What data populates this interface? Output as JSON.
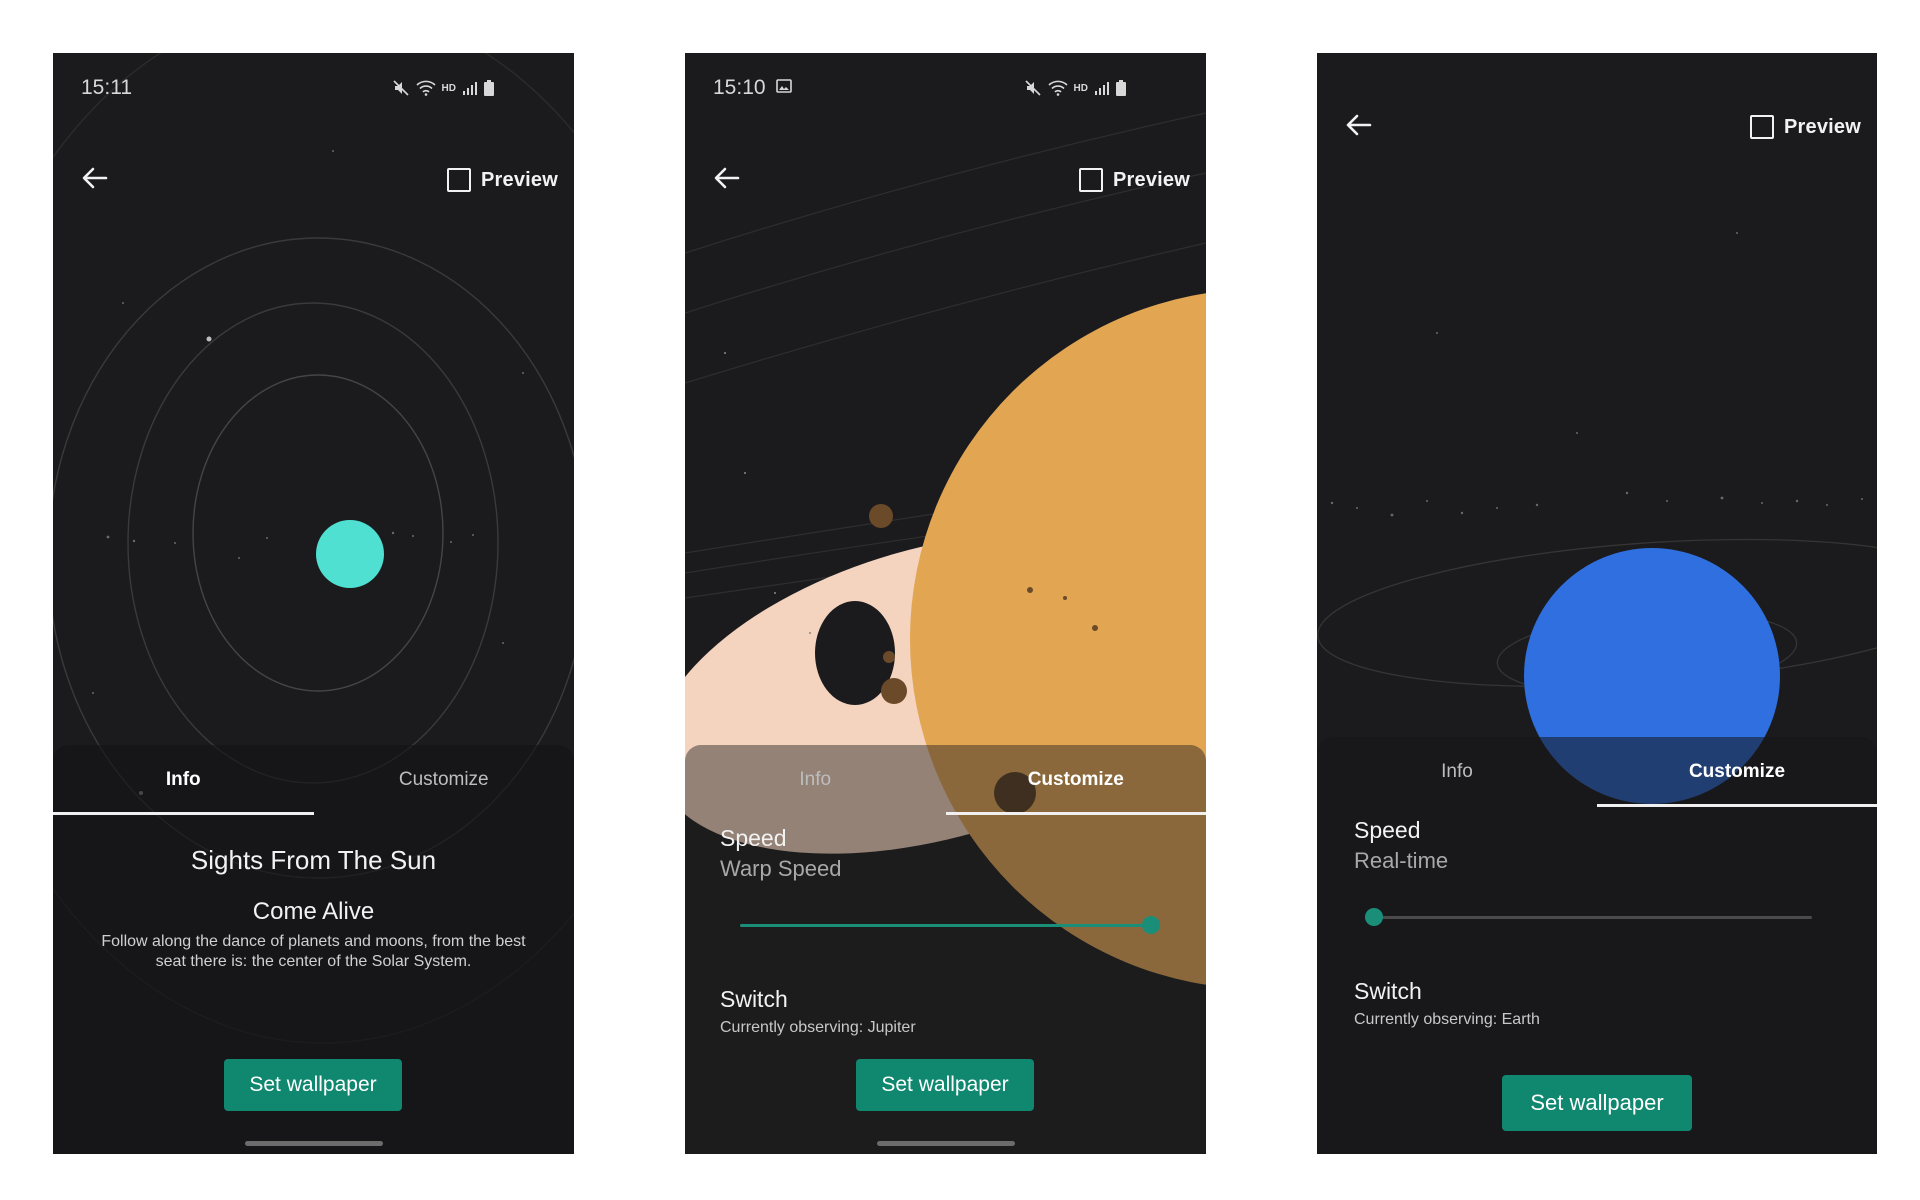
{
  "screens": [
    {
      "status": {
        "time": "15:11",
        "hd": "HD"
      },
      "topbar": {
        "preview_label": "Preview"
      },
      "tabs": [
        {
          "label": "Info",
          "active": true
        },
        {
          "label": "Customize",
          "active": false
        }
      ],
      "info": {
        "title": "Sights From The Sun",
        "subtitle": "Come Alive",
        "description": "Follow along the dance of planets and moons, from the best seat there is: the center of the Solar System."
      },
      "button": {
        "label": "Set wallpaper"
      },
      "planet_color": "#4fe0d2"
    },
    {
      "status": {
        "time": "15:10",
        "hd": "HD"
      },
      "topbar": {
        "preview_label": "Preview"
      },
      "tabs": [
        {
          "label": "Info",
          "active": false
        },
        {
          "label": "Customize",
          "active": true
        }
      ],
      "customize": {
        "speed_label": "Speed",
        "speed_value": "Warp Speed",
        "speed_level": 1.0,
        "switch_label": "Switch",
        "switch_value": "Currently observing: Jupiter"
      },
      "button": {
        "label": "Set wallpaper"
      },
      "planet_color": "#e2a552"
    },
    {
      "topbar": {
        "preview_label": "Preview"
      },
      "tabs": [
        {
          "label": "Info",
          "active": false
        },
        {
          "label": "Customize",
          "active": true
        }
      ],
      "customize": {
        "speed_label": "Speed",
        "speed_value": "Real-time",
        "speed_level": 0.0,
        "switch_label": "Switch",
        "switch_value": "Currently observing: Earth"
      },
      "button": {
        "label": "Set wallpaper"
      },
      "planet_color": "#2f6fe0"
    }
  ],
  "colors": {
    "background": "#1b1b1d",
    "accent": "#10876f",
    "slider_accent": "#1b8e79"
  },
  "icons": [
    "back-arrow-icon",
    "checkbox-icon",
    "mute-icon",
    "wifi-icon",
    "signal-icon",
    "battery-icon",
    "image-icon"
  ]
}
